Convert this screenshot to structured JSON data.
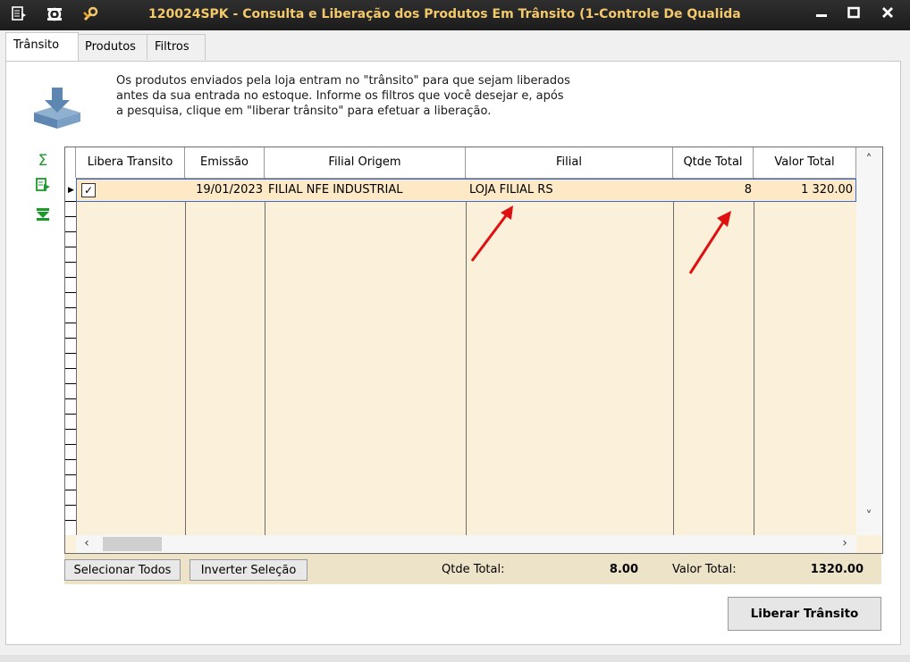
{
  "window": {
    "title": "120024SPK - Consulta e Liberação dos Produtos Em Trânsito (1-Controle De Qualida",
    "icons": [
      "menu-icon",
      "settings-icon",
      "tools-icon"
    ],
    "controls": [
      "minimize",
      "maximize",
      "close"
    ]
  },
  "tabs": [
    {
      "label": "Trânsito",
      "active": true
    },
    {
      "label": "Produtos",
      "active": false
    },
    {
      "label": "Filtros",
      "active": false
    }
  ],
  "help_lines": [
    "Os produtos enviados pela loja entram no \"trânsito\" para que sejam liberados",
    "antes da sua entrada no estoque. Informe os filtros que você desejar e, após",
    "a pesquisa, clique em \"liberar trânsito\" para efetuar a liberação."
  ],
  "sidebar_icons": [
    "sum-icon",
    "export-icon",
    "collapse-icon"
  ],
  "grid": {
    "columns": [
      "Libera Transito",
      "Emissão",
      "Filial Origem",
      "Filial",
      "Qtde Total",
      "Valor Total"
    ],
    "rows": [
      {
        "libera": true,
        "emissao": "19/01/2023",
        "filial_origem": "FILIAL NFE INDUSTRIAL",
        "filial": "LOJA FILIAL RS",
        "qtde_total": "8",
        "valor_total": "1 320.00"
      }
    ]
  },
  "footer": {
    "select_all": "Selecionar Todos",
    "invert": "Inverter Seleção",
    "qtde_label": "Qtde Total:",
    "qtde_value": "8.00",
    "valor_label": "Valor Total:",
    "valor_value": "1320.00"
  },
  "actions": {
    "release": "Liberar Trânsito"
  },
  "colors": {
    "accent_title": "#f3c96b",
    "row_bg": "#fbf0d9",
    "annotation_arrow": "#e01010"
  }
}
